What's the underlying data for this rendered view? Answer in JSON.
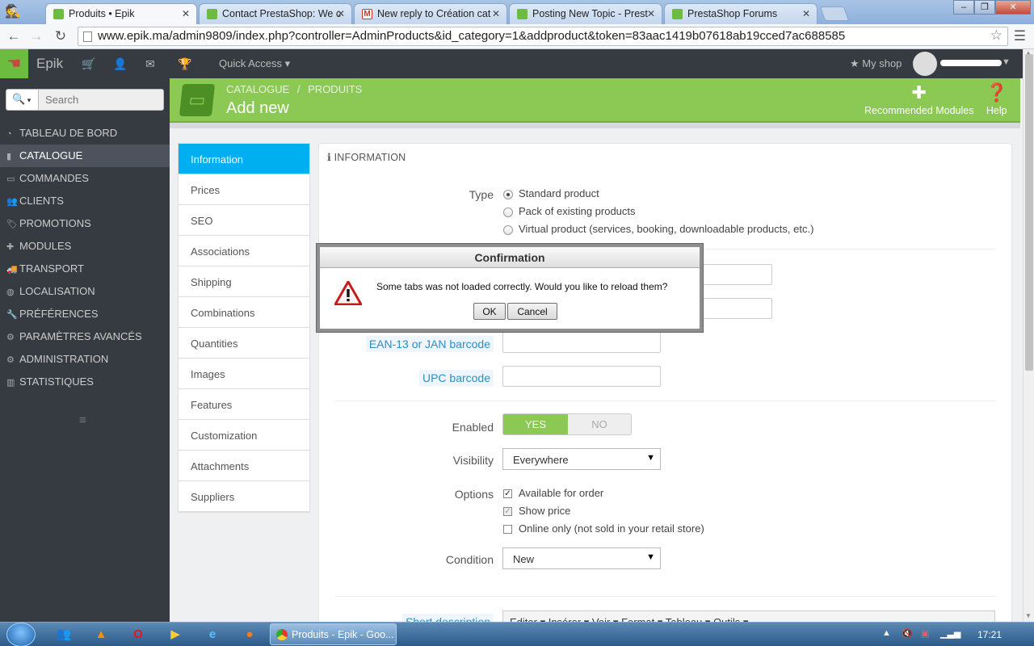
{
  "browser": {
    "tabs": [
      {
        "title": "Produits • Epik",
        "color": "#6cbd3f"
      },
      {
        "title": "Contact PrestaShop: We c",
        "color": "#6cbd3f"
      },
      {
        "title": "New reply to Création cat",
        "color": "#d93025"
      },
      {
        "title": "Posting New Topic - Prest",
        "color": "#6cbd3f"
      },
      {
        "title": "PrestaShop Forums",
        "color": "#6cbd3f"
      }
    ],
    "url": "www.epik.ma/admin9809/index.php?controller=AdminProducts&id_category=1&addproduct&token=83aac1419b07618ab19cced7ac688585"
  },
  "header": {
    "brand": "Epik",
    "quick_access": "Quick Access ▾",
    "my_shop": "My shop"
  },
  "sidebar": {
    "search_placeholder": "Search",
    "items": [
      {
        "label": "TABLEAU DE BORD",
        "icon": "dashboard-icon"
      },
      {
        "label": "CATALOGUE",
        "icon": "book-icon"
      },
      {
        "label": "COMMANDES",
        "icon": "credit-card-icon"
      },
      {
        "label": "CLIENTS",
        "icon": "users-icon"
      },
      {
        "label": "PROMOTIONS",
        "icon": "tag-icon"
      },
      {
        "label": "MODULES",
        "icon": "puzzle-icon"
      },
      {
        "label": "TRANSPORT",
        "icon": "truck-icon"
      },
      {
        "label": "LOCALISATION",
        "icon": "globe-icon"
      },
      {
        "label": "PRÉFÉRENCES",
        "icon": "wrench-icon"
      },
      {
        "label": "PARAMÈTRES AVANCÉS",
        "icon": "cogs-icon"
      },
      {
        "label": "ADMINISTRATION",
        "icon": "cog-icon"
      },
      {
        "label": "STATISTIQUES",
        "icon": "bar-chart-icon"
      }
    ]
  },
  "page": {
    "breadcrumb_1": "CATALOGUE",
    "breadcrumb_sep": "/",
    "breadcrumb_2": "PRODUITS",
    "title": "Add new",
    "recommended_modules": "Recommended Modules",
    "help": "Help"
  },
  "product_tabs": [
    "Information",
    "Prices",
    "SEO",
    "Associations",
    "Shipping",
    "Combinations",
    "Quantities",
    "Images",
    "Features",
    "Customization",
    "Attachments",
    "Suppliers"
  ],
  "form": {
    "panel_title": "INFORMATION",
    "type_label": "Type",
    "type_options": [
      "Standard product",
      "Pack of existing products",
      "Virtual product (services, booking, downloadable products, etc.)"
    ],
    "ean_label": "EAN-13 or JAN barcode",
    "upc_label": "UPC barcode",
    "enabled_label": "Enabled",
    "yes": "YES",
    "no": "NO",
    "visibility_label": "Visibility",
    "visibility_value": "Everywhere",
    "options_label": "Options",
    "options": [
      "Available for order",
      "Show price",
      "Online only (not sold in your retail store)"
    ],
    "condition_label": "Condition",
    "condition_value": "New",
    "short_description_label": "Short description",
    "editor_menu": "Editer ▾   Insérer ▾   Voir ▾   Format ▾   Tableau ▾   Outils ▾"
  },
  "dialog": {
    "title": "Confirmation",
    "message": "Some tabs was not loaded correctly. Would you like to reload them?",
    "ok": "OK",
    "cancel": "Cancel"
  },
  "taskbar": {
    "active_window": "Produits - Epik - Goo...",
    "clock": "17:21"
  }
}
